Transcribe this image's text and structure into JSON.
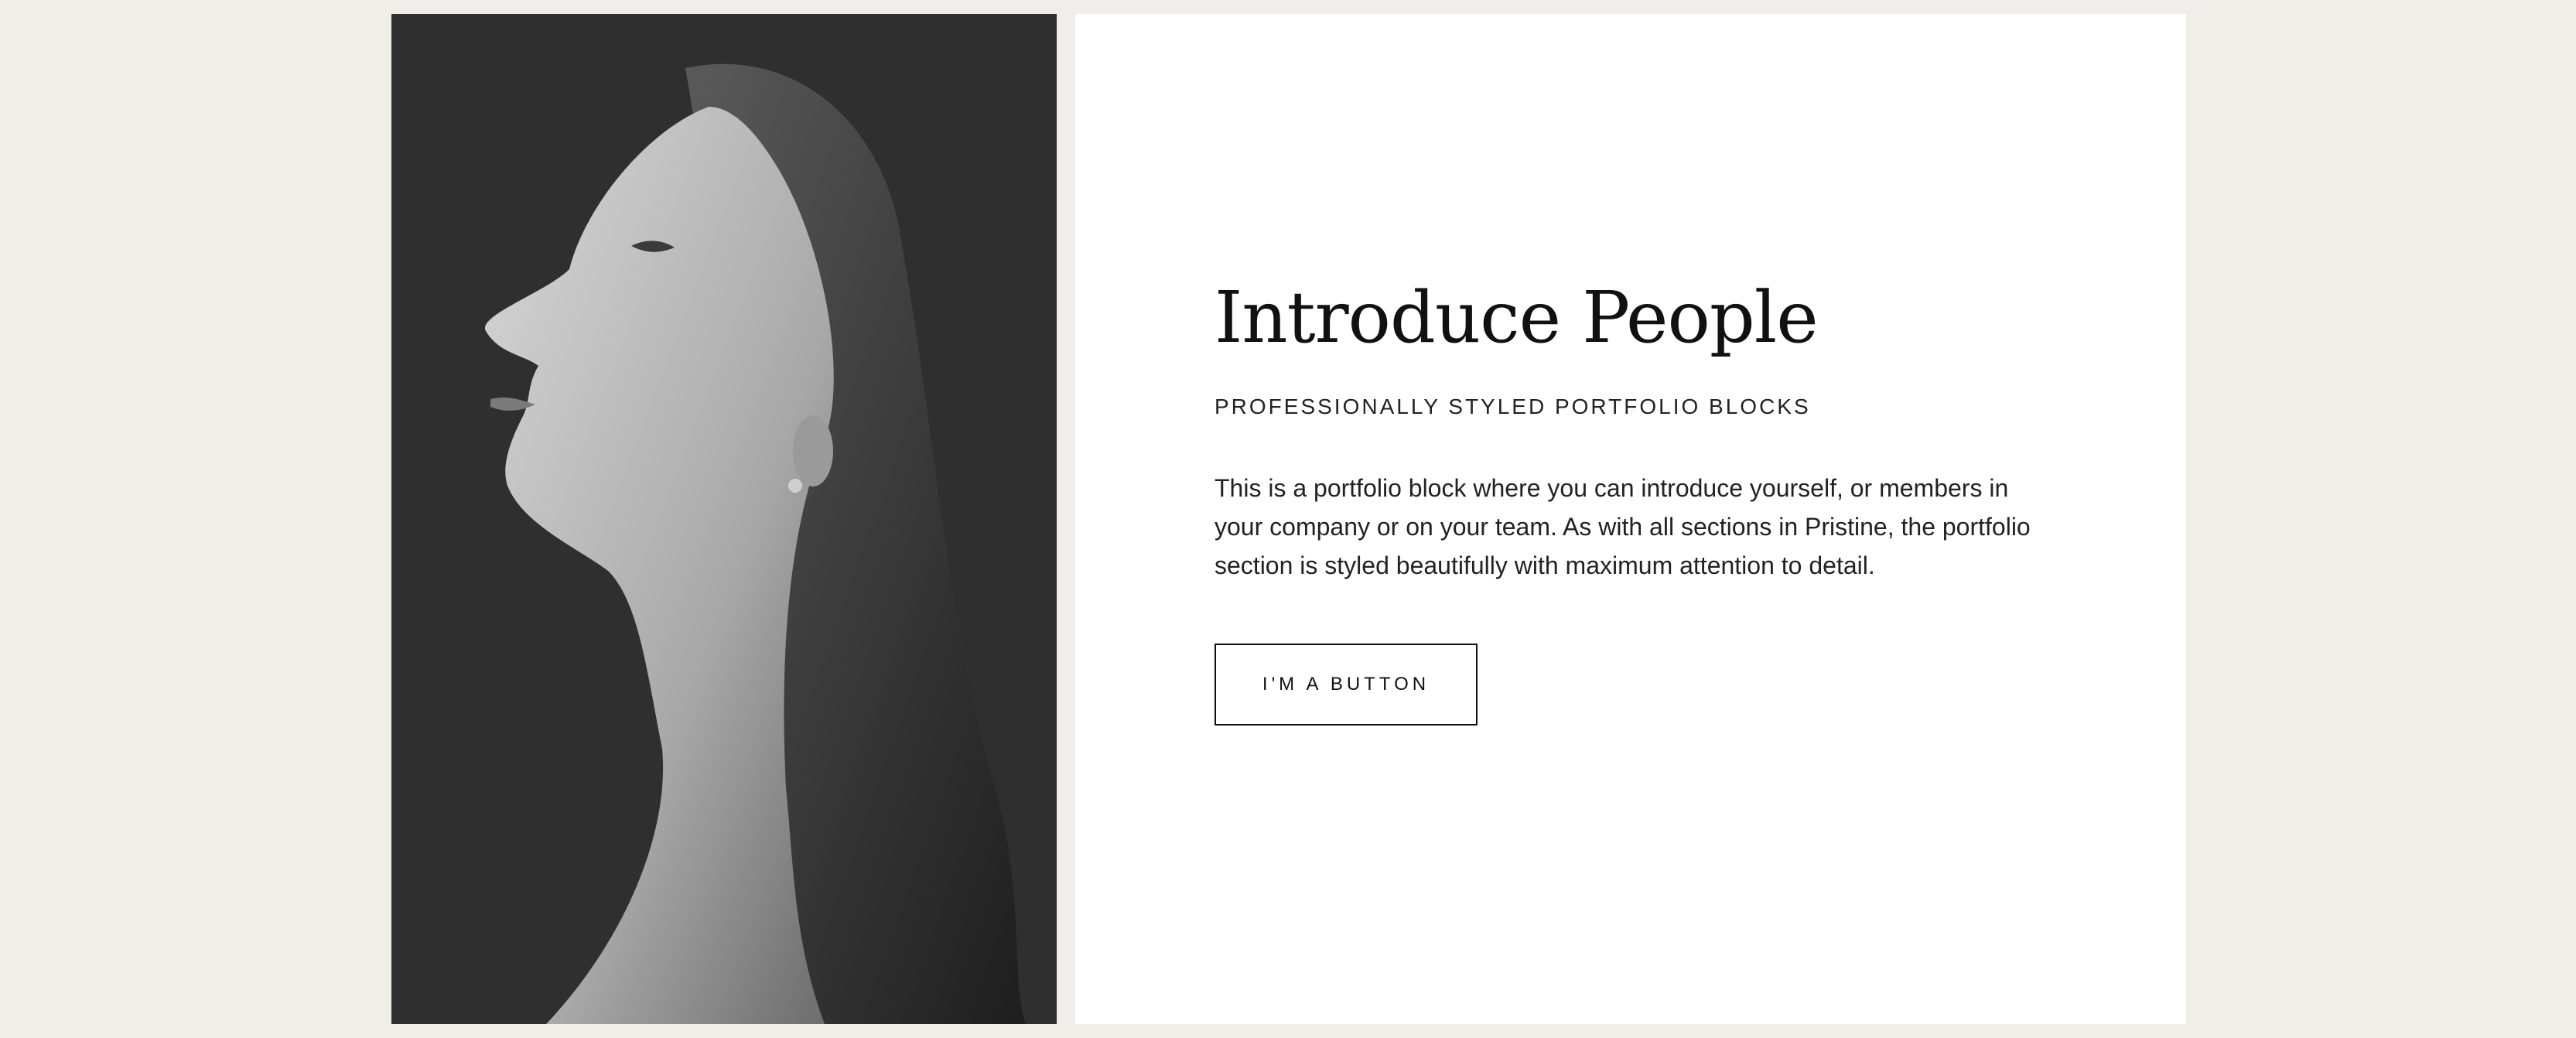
{
  "portfolio_block": {
    "image": {
      "alt_name": "portrait-photo"
    },
    "headline": "Introduce People",
    "subheadline": "PROFESSIONALLY STYLED PORTFOLIO BLOCKS",
    "body": "This is a portfolio block where you can introduce yourself, or members in your company or on your team. As with all sections in Pristine, the portfolio section is styled beautifully with maximum attention to detail.",
    "button_label": "I'M A BUTTON"
  },
  "colors": {
    "page_background": "#f1eeea",
    "panel_background": "#ffffff",
    "photo_background": "#2f2f2f",
    "text": "#111111"
  }
}
